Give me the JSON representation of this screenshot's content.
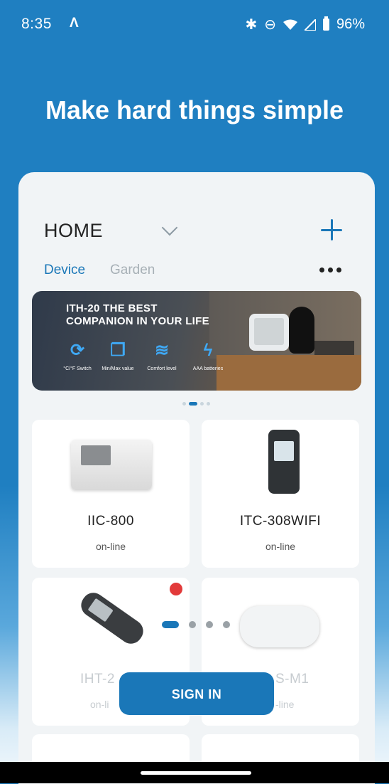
{
  "status_bar": {
    "time": "8:35",
    "app_glyph": "Λ",
    "battery": "96%",
    "icons": [
      "bluetooth-icon",
      "do-not-disturb-icon",
      "wifi-icon",
      "signal-icon",
      "battery-icon"
    ]
  },
  "headline": "Make hard things simple",
  "card": {
    "home_label": "HOME",
    "tabs": [
      {
        "label": "Device",
        "active": true
      },
      {
        "label": "Garden",
        "active": false
      }
    ],
    "banner": {
      "title_line1": "ITH-20  THE BEST",
      "title_line2": "COMPANION IN YOUR LIFE",
      "features": [
        {
          "label": "°C/°F Switch",
          "icon": "refresh-icon"
        },
        {
          "label": "Min/Max value",
          "icon": "copy-icon"
        },
        {
          "label": "Comfort level",
          "icon": "wind-icon"
        },
        {
          "label": "AAA batteries",
          "icon": "bolt-icon"
        }
      ]
    },
    "devices": [
      {
        "name": "IIC-800",
        "status": "on-line"
      },
      {
        "name": "ITC-308WIFI",
        "status": "on-line"
      },
      {
        "name": "IHT-2",
        "status": "on-li"
      },
      {
        "name": "S-M1",
        "status": "-line"
      }
    ]
  },
  "sign_in_label": "SIGN IN",
  "colors": {
    "primary": "#1a77b8",
    "background": "#1f7fc1",
    "alert": "#e23a3a"
  }
}
